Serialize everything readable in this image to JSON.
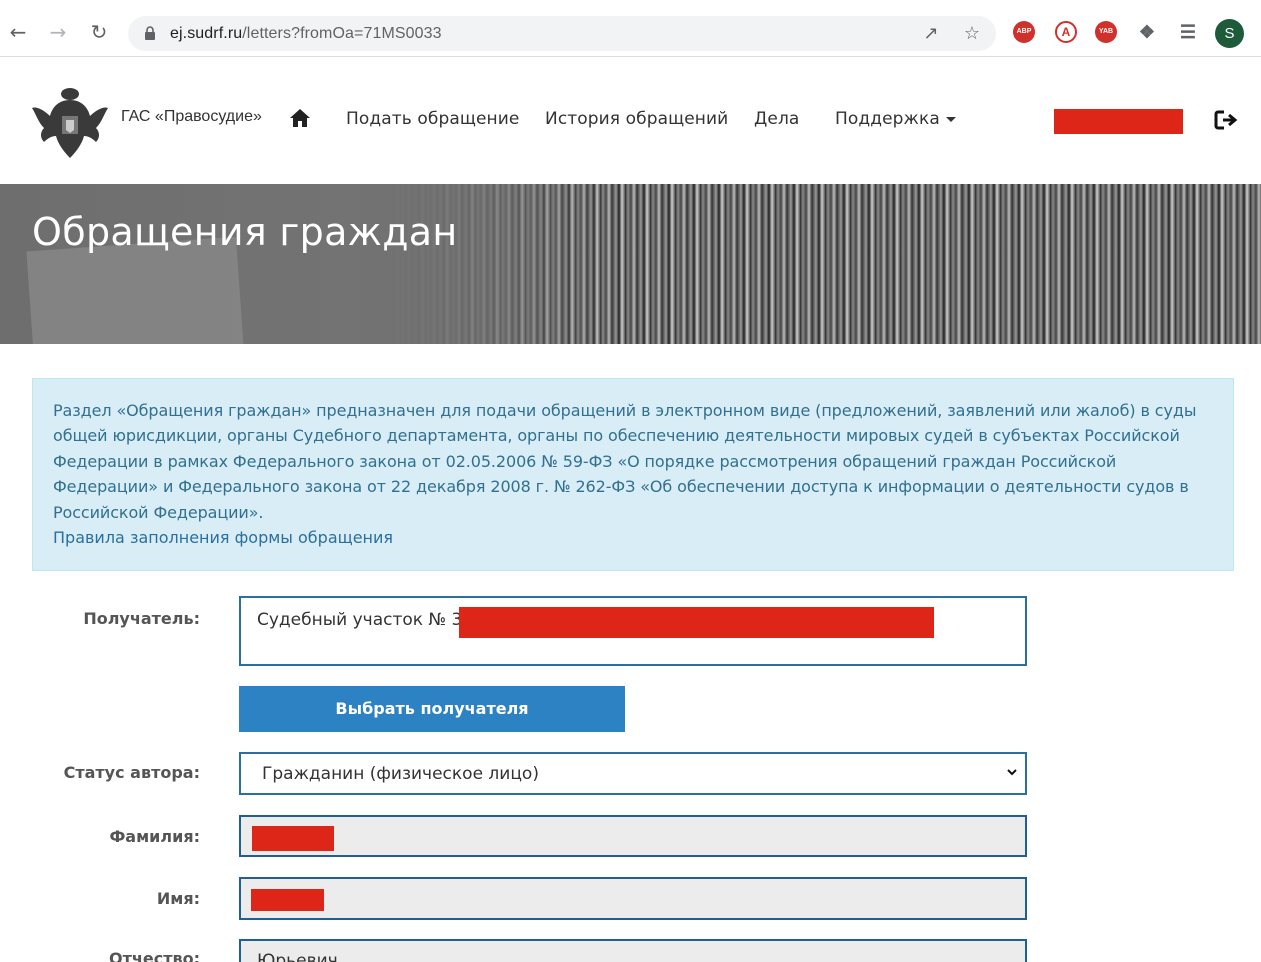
{
  "browser": {
    "url_host": "ej.sudrf.ru",
    "url_path": "/letters?fromOa=71MS0033",
    "extensions": [
      "ABP",
      "A",
      "YAB"
    ],
    "profile_initial": "S"
  },
  "header": {
    "brand": "ГАС «Правосудие»",
    "menu": [
      {
        "label": "Подать обращение"
      },
      {
        "label": "История обращений"
      },
      {
        "label": "Дела"
      },
      {
        "label": "Поддержка"
      }
    ]
  },
  "banner": {
    "title": "Обращения граждан"
  },
  "info": {
    "text": "Раздел «Обращения граждан» предназначен для подачи обращений в электронном виде (предложений, заявлений или жалоб) в суды общей юрисдикции, органы Судебного департамента, органы по обеспечению деятельности мировых судей в субъектах Российской Федерации в рамках Федерального закона от 02.05.2006 № 59-ФЗ «О порядке рассмотрения обращений граждан Российской Федерации» и Федерального закона от 22 декабря 2008 г. № 262-ФЗ «Об обеспечении доступа к информации о деятельности судов в Российской Федерации».",
    "link": "Правила заполнения формы обращения"
  },
  "form": {
    "recipient_label": "Получатель:",
    "recipient_value": "Судебный участок № 33",
    "choose_recipient_button": "Выбрать получателя",
    "author_status_label": "Статус автора:",
    "author_status_value": "Гражданин (физическое лицо)",
    "surname_label": "Фамилия:",
    "name_label": "Имя:",
    "patronymic_label": "Отчество:",
    "patronymic_value": "Юрьевич"
  },
  "colors": {
    "redaction": "#dd2518",
    "primary_button": "#2d82c4",
    "info_bg": "#d9edf7",
    "info_text": "#31708f"
  }
}
